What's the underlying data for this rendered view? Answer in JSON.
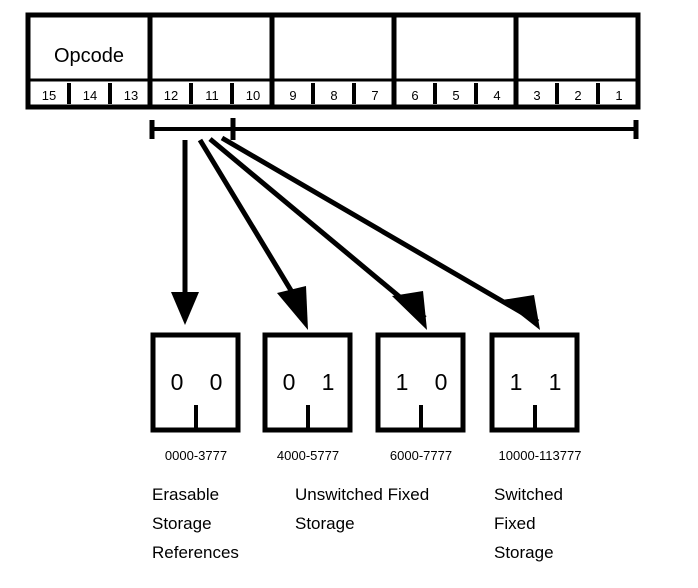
{
  "diagram": {
    "title_text": "Opcode",
    "word_field": {
      "name": "instruction-word",
      "cells": [
        {
          "label": "Opcode",
          "bits": [
            "15",
            "14",
            "13"
          ]
        },
        {
          "label": "",
          "bits": [
            "12",
            "11",
            "10"
          ]
        },
        {
          "label": "",
          "bits": [
            "9",
            "8",
            "7"
          ]
        },
        {
          "label": "",
          "bits": [
            "6",
            "5",
            "4"
          ]
        },
        {
          "label": "",
          "bits": [
            "3",
            "2",
            "1"
          ]
        }
      ]
    },
    "bracket": {
      "name": "address-field-bracket",
      "tick_note": ""
    },
    "address_boxes": [
      {
        "bits": [
          "0",
          "0"
        ],
        "range": "0000-3777"
      },
      {
        "bits": [
          "0",
          "1"
        ],
        "range": "4000-5777"
      },
      {
        "bits": [
          "1",
          "0"
        ],
        "range": "6000-7777"
      },
      {
        "bits": [
          "1",
          "1"
        ],
        "range": "10000-113777"
      }
    ],
    "captions": [
      {
        "lines": [
          "Erasable",
          "Storage",
          "References"
        ]
      },
      {
        "lines": [
          "Unswitched Fixed",
          "Storage"
        ]
      },
      {
        "lines": [
          "Switched",
          "Fixed",
          "Storage"
        ]
      }
    ],
    "colors": {
      "line": "#000000",
      "background": "#ffffff",
      "text": "#000000"
    }
  }
}
